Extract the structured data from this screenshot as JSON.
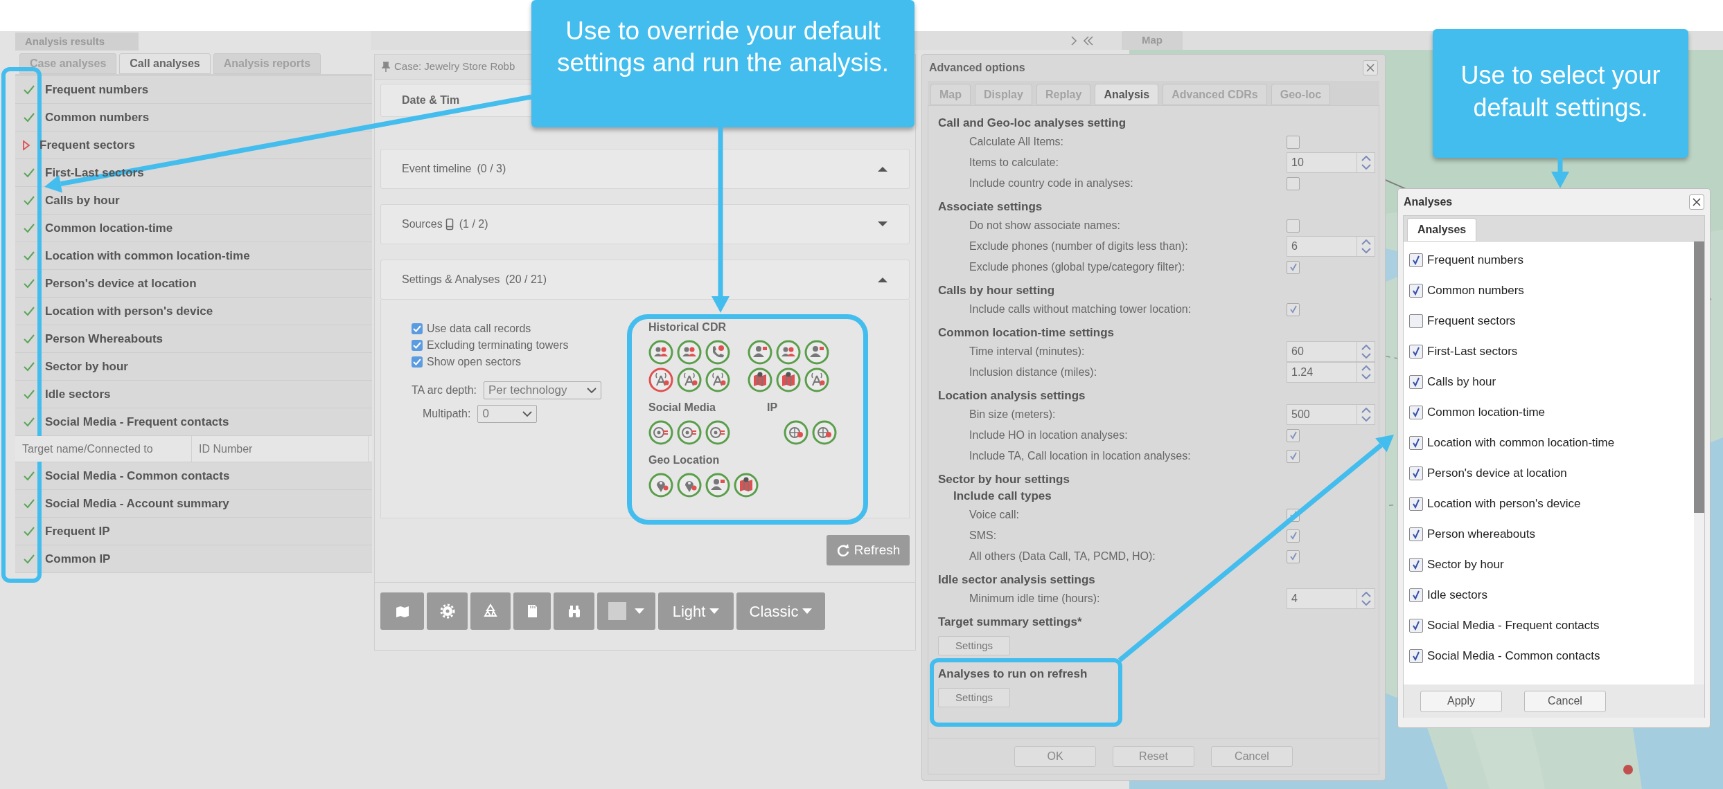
{
  "results_panel": {
    "title": "Analysis results",
    "tabs": [
      {
        "label": "Case analyses",
        "selected": false
      },
      {
        "label": "Call analyses",
        "selected": true
      },
      {
        "label": "Analysis reports",
        "selected": false
      }
    ],
    "rows": [
      {
        "kind": "done",
        "label": "Frequent numbers"
      },
      {
        "kind": "done",
        "label": "Common numbers"
      },
      {
        "kind": "pending",
        "label": "Frequent sectors"
      },
      {
        "kind": "done",
        "label": "First-Last sectors"
      },
      {
        "kind": "done",
        "label": "Calls by hour"
      },
      {
        "kind": "done",
        "label": "Common location-time"
      },
      {
        "kind": "done",
        "label": "Location with common location-time"
      },
      {
        "kind": "done",
        "label": "Person's device at location"
      },
      {
        "kind": "done",
        "label": "Location with person's device"
      },
      {
        "kind": "done",
        "label": "Person Whereabouts"
      },
      {
        "kind": "done",
        "label": "Sector by hour"
      },
      {
        "kind": "done",
        "label": "Idle sectors"
      },
      {
        "kind": "done",
        "label": "Social Media - Frequent contacts"
      },
      {
        "kind": "header",
        "columns": [
          "Target name/Connected to",
          "ID Number"
        ]
      },
      {
        "kind": "done",
        "label": "Social Media - Common contacts"
      },
      {
        "kind": "done",
        "label": "Social Media - Account summary"
      },
      {
        "kind": "done",
        "label": "Frequent IP"
      },
      {
        "kind": "done",
        "label": "Common IP"
      }
    ]
  },
  "map_strip": {
    "tab": "Map"
  },
  "case_panel": {
    "title": "Case: Jewelry Store Robb",
    "first_section": "Date & Tim",
    "sections": [
      {
        "title": "Event timeline",
        "count": "(0 / 3)",
        "expanded": true
      },
      {
        "title": "Sources",
        "count": "(1 / 2)",
        "expanded": false
      },
      {
        "title": "Settings & Analyses",
        "count": "(20 / 21)",
        "expanded": true
      }
    ],
    "options": [
      {
        "label": "Use data call records",
        "checked": true
      },
      {
        "label": "Excluding terminating towers",
        "checked": true
      },
      {
        "label": "Show open sectors",
        "checked": true
      }
    ],
    "selects": [
      {
        "label": "TA arc depth:",
        "value": "Per technology"
      },
      {
        "label": "Multipath:",
        "value": "0"
      }
    ],
    "icon_rows": [
      {
        "groups": [
          {
            "title": "Historical CDR",
            "icons": [
              {
                "kind": "people",
                "enabled": true
              },
              {
                "kind": "people",
                "enabled": true
              },
              {
                "kind": "phone",
                "enabled": true
              },
              {
                "kind": "person",
                "enabled": true
              },
              {
                "kind": "people",
                "enabled": true
              },
              {
                "kind": "person",
                "enabled": true
              },
              {
                "kind": "antenna",
                "enabled": false
              },
              {
                "kind": "antenna",
                "enabled": true
              },
              {
                "kind": "antenna",
                "enabled": true
              },
              {
                "kind": "map",
                "enabled": true
              },
              {
                "kind": "map",
                "enabled": true
              },
              {
                "kind": "antenna",
                "enabled": true
              }
            ]
          }
        ]
      },
      {
        "groups": [
          {
            "title": "Social Media",
            "icons": [
              {
                "kind": "at",
                "enabled": true
              },
              {
                "kind": "at",
                "enabled": true
              },
              {
                "kind": "at",
                "enabled": true
              }
            ]
          },
          {
            "title": "IP",
            "icons": [
              {
                "kind": "globe",
                "enabled": true
              },
              {
                "kind": "globe",
                "enabled": true
              }
            ]
          }
        ]
      },
      {
        "groups": [
          {
            "title": "Geo Location",
            "icons": [
              {
                "kind": "pin",
                "enabled": true
              },
              {
                "kind": "pin",
                "enabled": true
              },
              {
                "kind": "person",
                "enabled": true
              },
              {
                "kind": "map",
                "enabled": true
              }
            ]
          }
        ]
      }
    ],
    "refresh": "Refresh",
    "toolbar": [
      {
        "kind": "icon"
      },
      {
        "kind": "icon"
      },
      {
        "kind": "icon"
      },
      {
        "kind": "icon"
      },
      {
        "kind": "icon"
      },
      {
        "kind": "color"
      },
      {
        "kind": "menu",
        "label": "Light"
      },
      {
        "kind": "menu",
        "label": "Classic"
      }
    ]
  },
  "advanced_options": {
    "title": "Advanced options",
    "tabs": [
      {
        "label": "Map",
        "selected": false
      },
      {
        "label": "Display",
        "selected": false
      },
      {
        "label": "Replay",
        "selected": false
      },
      {
        "label": "Analysis",
        "selected": true
      },
      {
        "label": "Advanced CDRs",
        "selected": false
      },
      {
        "label": "Geo-loc",
        "selected": false
      }
    ],
    "items": [
      {
        "kind": "heading",
        "label": "Call and Geo-loc analyses setting"
      },
      {
        "kind": "checkbox",
        "label": "Calculate All Items:",
        "checked": false
      },
      {
        "kind": "spinner",
        "label": "Items to calculate:",
        "value": "10"
      },
      {
        "kind": "checkbox",
        "label": "Include country code in analyses:",
        "checked": false
      },
      {
        "kind": "heading",
        "label": "Associate settings"
      },
      {
        "kind": "checkbox",
        "label": "Do not show associate names:",
        "checked": false
      },
      {
        "kind": "spinner",
        "label": "Exclude phones (number of digits less than):",
        "value": "6"
      },
      {
        "kind": "checkbox",
        "label": "Exclude phones (global type/category filter):",
        "checked": true
      },
      {
        "kind": "heading",
        "label": "Calls by hour setting"
      },
      {
        "kind": "checkbox",
        "label": "Include calls without matching tower location:",
        "checked": true
      },
      {
        "kind": "heading",
        "label": "Common location-time settings"
      },
      {
        "kind": "spinner",
        "label": "Time interval (minutes):",
        "value": "60"
      },
      {
        "kind": "spinner",
        "label": "Inclusion distance (miles):",
        "value": "1.24"
      },
      {
        "kind": "heading",
        "label": "Location analysis settings"
      },
      {
        "kind": "spinner",
        "label": "Bin size (meters):",
        "value": "500"
      },
      {
        "kind": "checkbox",
        "label": "Include HO in location analyses:",
        "checked": true
      },
      {
        "kind": "checkbox",
        "label": "Include TA, Call location in location analyses:",
        "checked": true
      },
      {
        "kind": "heading",
        "label": "Sector by hour settings"
      },
      {
        "kind": "subheading",
        "label": "Include call types"
      },
      {
        "kind": "checkbox",
        "label": "Voice call:",
        "checked": true
      },
      {
        "kind": "checkbox",
        "label": "SMS:",
        "checked": true
      },
      {
        "kind": "checkbox",
        "label": "All others (Data Call, TA, PCMD, HO):",
        "checked": true
      },
      {
        "kind": "heading",
        "label": "Idle sector analysis settings"
      },
      {
        "kind": "spinner",
        "label": "Minimum idle time (hours):",
        "value": "4"
      },
      {
        "kind": "heading",
        "label": "Target summary settings*"
      },
      {
        "kind": "button",
        "label": "Settings"
      },
      {
        "kind": "heading",
        "label": "Analyses to run on refresh"
      },
      {
        "kind": "button",
        "label": "Settings"
      }
    ],
    "buttons": [
      "OK",
      "Reset",
      "Cancel"
    ]
  },
  "analyses_dialog": {
    "title": "Analyses",
    "tab": "Analyses",
    "items": [
      {
        "label": "Frequent numbers",
        "checked": true
      },
      {
        "label": "Common numbers",
        "checked": true
      },
      {
        "label": "Frequent sectors",
        "checked": false
      },
      {
        "label": "First-Last sectors",
        "checked": true
      },
      {
        "label": "Calls by hour",
        "checked": true
      },
      {
        "label": "Common location-time",
        "checked": true
      },
      {
        "label": "Location with common location-time",
        "checked": true
      },
      {
        "label": "Person's device at location",
        "checked": true
      },
      {
        "label": "Location with person's device",
        "checked": true
      },
      {
        "label": "Person whereabouts",
        "checked": true
      },
      {
        "label": "Sector by hour",
        "checked": true
      },
      {
        "label": "Idle sectors",
        "checked": true
      },
      {
        "label": "Social Media - Frequent contacts",
        "checked": true
      },
      {
        "label": "Social Media - Common contacts",
        "checked": true
      }
    ],
    "buttons": [
      "Apply",
      "Cancel"
    ]
  },
  "callouts": [
    {
      "text": "Use to override your default settings and run the analysis."
    },
    {
      "text": "Use to select your default settings."
    }
  ]
}
